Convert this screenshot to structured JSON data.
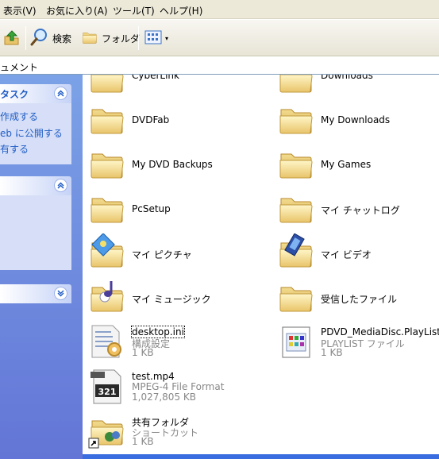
{
  "menu": {
    "view": "表示(V)",
    "favorites": "お気に入り(A)",
    "tools": "ツール(T)",
    "help": "ヘルプ(H)"
  },
  "toolbar": {
    "search_label": "検索",
    "folders_label": "フォルダ"
  },
  "address": {
    "path": "ュメント"
  },
  "tasks_panel": {
    "title": "タスク",
    "links": [
      "作成する",
      "eb に公開する",
      "有する"
    ]
  },
  "files": [
    {
      "name": "CyberLink",
      "icon": "folder-icon"
    },
    {
      "name": "Downloads",
      "icon": "folder-icon"
    },
    {
      "name": "DVDFab",
      "icon": "folder-icon"
    },
    {
      "name": "My Downloads",
      "icon": "folder-icon"
    },
    {
      "name": "My DVD Backups",
      "icon": "folder-icon"
    },
    {
      "name": "My Games",
      "icon": "folder-icon"
    },
    {
      "name": "PcSetup",
      "icon": "folder-icon"
    },
    {
      "name": "マイ チャットログ",
      "icon": "folder-icon"
    },
    {
      "name": "マイ ピクチャ",
      "icon": "pictures-folder-icon"
    },
    {
      "name": "マイ ビデオ",
      "icon": "video-folder-icon"
    },
    {
      "name": "マイ ミュージック",
      "icon": "music-folder-icon"
    },
    {
      "name": "受信したファイル",
      "icon": "folder-icon"
    },
    {
      "name": "desktop.ini",
      "type": "構成設定",
      "size": "1 KB",
      "icon": "settings-file-icon"
    },
    {
      "name": "PDVD_MediaDisc.PlayList",
      "type": "PLAYLIST ファイル",
      "size": "1 KB",
      "icon": "playlist-file-icon"
    },
    {
      "name": "test.mp4",
      "type": "MPEG-4 File Format",
      "size": "1,027,805 KB",
      "icon": "mp4-file-icon"
    },
    {
      "name": "共有フォルダ",
      "type": "ショートカット",
      "size": "1 KB",
      "icon": "shortcut-folder-icon"
    }
  ]
}
